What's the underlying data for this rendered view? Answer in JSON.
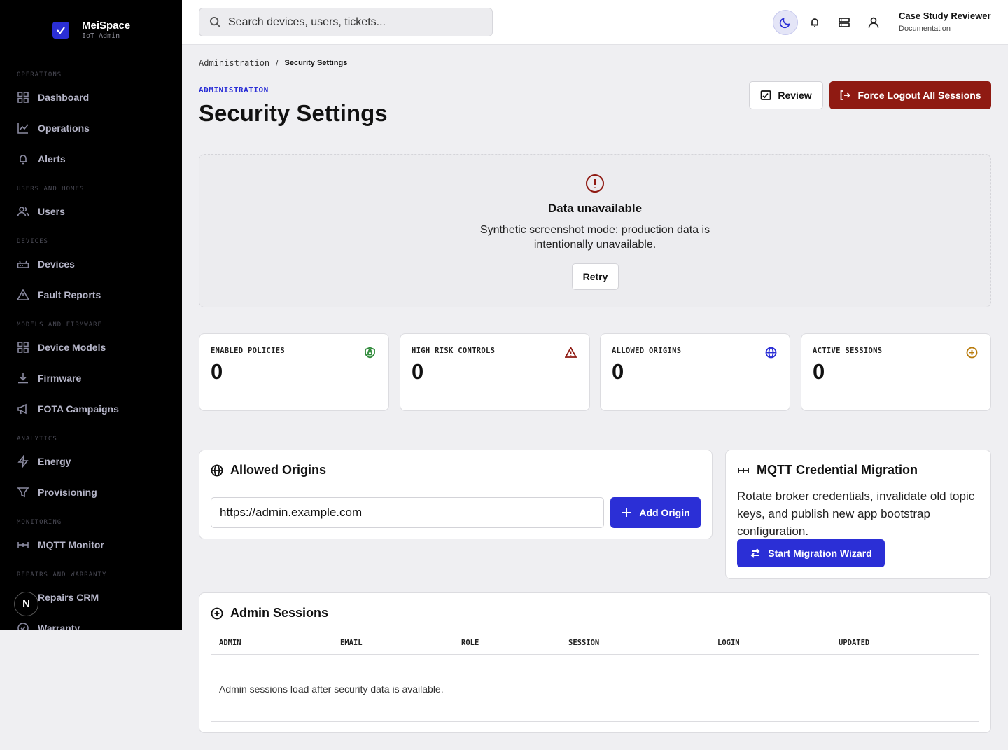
{
  "brand": {
    "name": "MeiSpace",
    "sub": "IoT Admin"
  },
  "sidebar": {
    "sections": [
      "Operations",
      "Users and Homes",
      "Devices",
      "Models and Firmware",
      "Analytics",
      "Monitoring",
      "Repairs and Warranty"
    ],
    "items": [
      {
        "label": "Dashboard",
        "icon": "grid-icon"
      },
      {
        "label": "Operations",
        "icon": "chart-line-icon"
      },
      {
        "label": "Alerts",
        "icon": "bell-icon"
      },
      {
        "label": "Users",
        "icon": "users-icon"
      },
      {
        "label": "Devices",
        "icon": "router-icon"
      },
      {
        "label": "Fault Reports",
        "icon": "warning-icon"
      },
      {
        "label": "Device Models",
        "icon": "grid-icon"
      },
      {
        "label": "Firmware",
        "icon": "download-icon"
      },
      {
        "label": "FOTA Campaigns",
        "icon": "megaphone-icon"
      },
      {
        "label": "Energy",
        "icon": "bolt-icon"
      },
      {
        "label": "Provisioning",
        "icon": "filter-icon"
      },
      {
        "label": "MQTT Monitor",
        "icon": "network-icon"
      },
      {
        "label": "Repairs CRM",
        "icon": "wrench-icon"
      },
      {
        "label": "Warranty",
        "icon": "check-circle-icon"
      }
    ],
    "badge": "N"
  },
  "topbar": {
    "search_placeholder": "Search devices, users, tickets...",
    "user_name": "Case Study Reviewer",
    "user_role": "Documentation"
  },
  "breadcrumb": {
    "parent": "Administration",
    "current": "Security Settings"
  },
  "header": {
    "eyebrow": "ADMINISTRATION",
    "title": "Security Settings",
    "review_label": "Review",
    "logout_label": "Force Logout All Sessions"
  },
  "unavailable": {
    "title": "Data unavailable",
    "message": "Synthetic screenshot mode: production data is intentionally unavailable.",
    "retry_label": "Retry"
  },
  "stats": [
    {
      "label": "ENABLED POLICIES",
      "value": "0",
      "color": "#2f8a3a"
    },
    {
      "label": "HIGH RISK CONTROLS",
      "value": "0",
      "color": "#8f1a12"
    },
    {
      "label": "ALLOWED ORIGINS",
      "value": "0",
      "color": "#2b2fd6"
    },
    {
      "label": "ACTIVE SESSIONS",
      "value": "0",
      "color": "#b87a0a"
    }
  ],
  "origins": {
    "title": "Allowed Origins",
    "input_value": "https://admin.example.com",
    "add_label": "Add Origin"
  },
  "mqtt": {
    "title": "MQTT Credential Migration",
    "description": "Rotate broker credentials, invalidate old topic keys, and publish new app bootstrap configuration.",
    "wizard_label": "Start Migration Wizard"
  },
  "sessions": {
    "title": "Admin Sessions",
    "columns": [
      "ADMIN",
      "EMAIL",
      "ROLE",
      "SESSION",
      "LOGIN",
      "UPDATED"
    ],
    "empty": "Admin sessions load after security data is available."
  },
  "colors": {
    "accent": "#2b2fd6",
    "danger": "#8f1a12",
    "sidebar": "#000000"
  }
}
